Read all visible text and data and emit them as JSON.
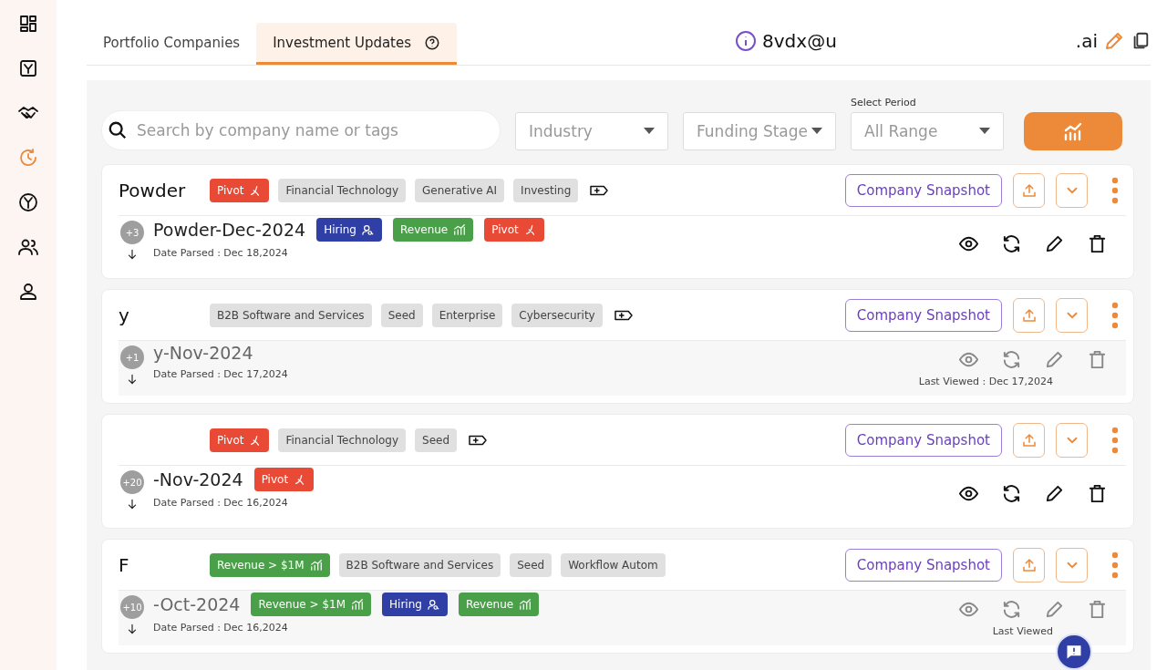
{
  "sidebar": {
    "items": [
      {
        "kind": "dashboard",
        "selected": false
      },
      {
        "kind": "y-box",
        "selected": false
      },
      {
        "kind": "handshake",
        "selected": false
      },
      {
        "kind": "clock",
        "selected": true
      },
      {
        "kind": "y-circle",
        "selected": false
      },
      {
        "kind": "people",
        "selected": false
      },
      {
        "kind": "person",
        "selected": false
      }
    ]
  },
  "tabs": [
    {
      "label": "Portfolio Companies",
      "selected": false,
      "help": false
    },
    {
      "label": "Investment Updates",
      "selected": true,
      "help": true
    }
  ],
  "email": {
    "start": "8vdx@u",
    "end": ".ai"
  },
  "filters": {
    "search": {
      "placeholder": "Search by company name or tags"
    },
    "industry": {
      "placeholder": "Industry"
    },
    "funding_stage": {
      "placeholder": "Funding Stage"
    },
    "period": {
      "label": "Select Period",
      "value": "All Range"
    }
  },
  "companies": [
    {
      "name": "Powder",
      "tags": [
        {
          "kind": "pivot",
          "label": "Pivot"
        },
        {
          "kind": "plain",
          "label": "Financial Technology"
        },
        {
          "kind": "plain",
          "label": "Generative AI"
        },
        {
          "kind": "plain",
          "label": "Investing"
        }
      ],
      "add_tag": true,
      "snapshot": "Company Snapshot",
      "count": "+3",
      "update": "Powder-Dec-2024",
      "update_tags": [
        {
          "kind": "hiring",
          "label": "Hiring"
        },
        {
          "kind": "revenue",
          "label": "Revenue"
        },
        {
          "kind": "pivot",
          "label": "Pivot"
        }
      ],
      "date_parsed": "Date Parsed : Dec 18,2024",
      "viewed": false
    },
    {
      "name": "y",
      "tags": [
        {
          "kind": "plain",
          "label": "B2B Software and Services"
        },
        {
          "kind": "plain",
          "label": "Seed"
        },
        {
          "kind": "plain",
          "label": "Enterprise"
        },
        {
          "kind": "plain",
          "label": "Cybersecurity"
        }
      ],
      "add_tag": true,
      "snapshot": "Company Snapshot",
      "count": "+1",
      "update": "y-Nov-2024",
      "date_parsed": "Date Parsed : Dec 17,2024",
      "viewed": true,
      "last_viewed": "Last Viewed : Dec 17,2024"
    },
    {
      "tags": [
        {
          "kind": "pivot",
          "label": "Pivot"
        },
        {
          "kind": "plain",
          "label": "Financial Technology"
        },
        {
          "kind": "plain",
          "label": "Seed"
        }
      ],
      "add_tag": true,
      "snapshot": "Company Snapshot",
      "count": "+20",
      "update": "-Nov-2024",
      "update_tags": [
        {
          "kind": "pivot",
          "label": "Pivot"
        }
      ],
      "date_parsed": "Date Parsed : Dec 16,2024",
      "viewed": false
    },
    {
      "name": "F",
      "tags": [
        {
          "kind": "revenue",
          "label": "Revenue > $1M"
        },
        {
          "kind": "plain",
          "label": "B2B Software and Services"
        },
        {
          "kind": "plain",
          "label": "Seed"
        },
        {
          "kind": "plain",
          "label": "Workflow Autom"
        }
      ],
      "add_tag": false,
      "snapshot": "Company Snapshot",
      "count": "+10",
      "update": "-Oct-2024",
      "update_tags": [
        {
          "kind": "revenue",
          "label": "Revenue > $1M"
        },
        {
          "kind": "hiring",
          "label": "Hiring"
        },
        {
          "kind": "revenue",
          "label": "Revenue"
        }
      ],
      "date_parsed": "Date Parsed : Dec 16,2024",
      "viewed": true,
      "last_viewed": "Last Viewed"
    }
  ]
}
